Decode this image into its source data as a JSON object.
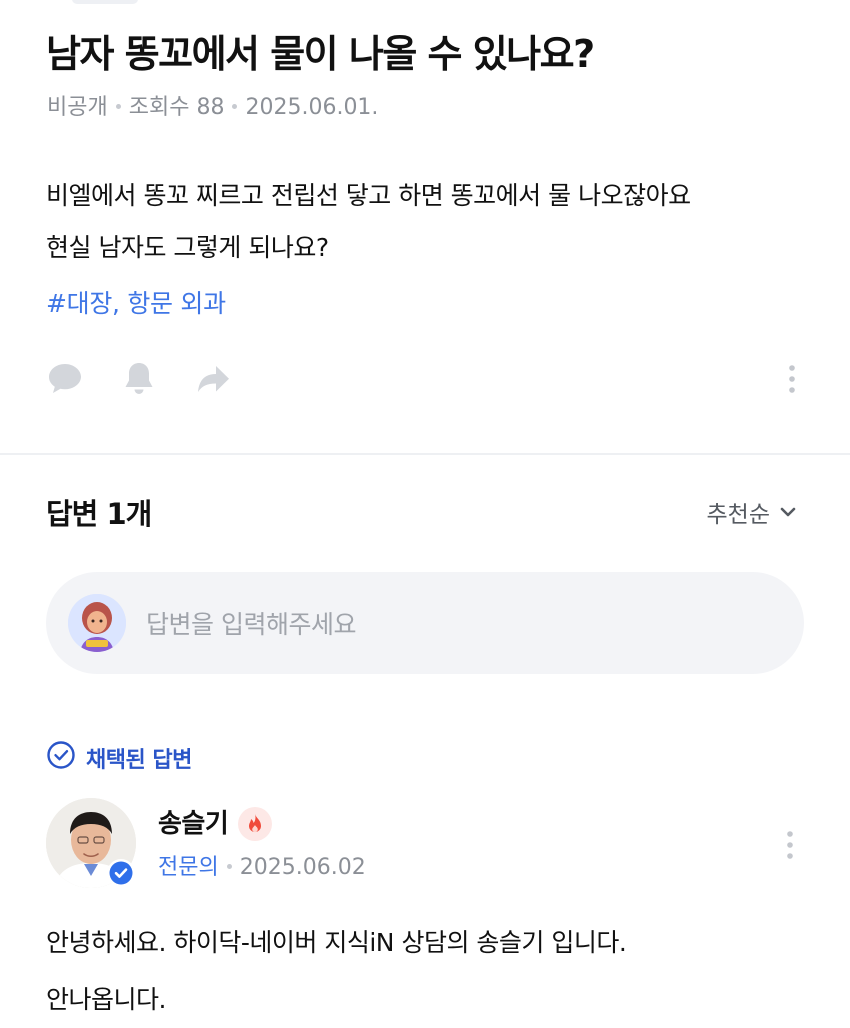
{
  "question": {
    "title": "남자 똥꼬에서 물이 나올 수 있나요?",
    "visibility": "비공개",
    "views_label": "조회수",
    "views": "88",
    "date": "2025.06.01.",
    "body_lines": [
      "비엘에서 똥꼬 찌르고 전립선 닿고 하면 똥꼬에서 물 나오잖아요",
      "현실 남자도 그렇게 되나요?"
    ],
    "tags": "#대장, 항문 외과"
  },
  "answers_header": {
    "title": "답변 1개",
    "sort_label": "추천순"
  },
  "answer_input": {
    "placeholder": "답변을 입력해주세요"
  },
  "answer": {
    "selected_label": "채택된 답변",
    "author_name": "송슬기",
    "author_role": "전문의",
    "date": "2025.06.02",
    "body_lines": [
      "안녕하세요. 하이닥-네이버 지식iN 상담의 송슬기 입니다.",
      "안나옵니다."
    ]
  },
  "colors": {
    "accent_blue": "#3f76e6",
    "selected_blue": "#2a55c8",
    "icon_gray": "#d3d6db",
    "meta_gray": "#8b8f96",
    "fire_red": "#f04a3a"
  },
  "icons": [
    "comment-icon",
    "bell-icon",
    "share-icon",
    "more-icon",
    "chevron-down-icon",
    "check-circle-icon",
    "fire-icon",
    "verified-icon"
  ]
}
